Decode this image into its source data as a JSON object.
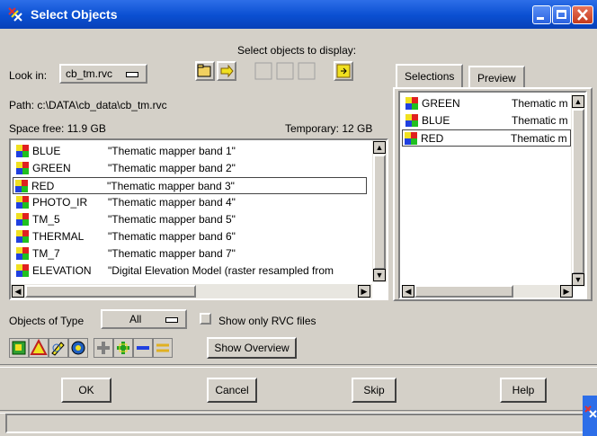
{
  "window": {
    "title": "Select Objects",
    "buttons": [
      "minimize-icon",
      "maximize-icon",
      "close-icon"
    ]
  },
  "header": {
    "prompt": "Select objects to display:"
  },
  "lookin": {
    "label": "Look in:",
    "value": "cb_tm.rvc"
  },
  "path": "Path: c:\\DATA\\cb_data\\cb_tm.rvc",
  "space_free": "Space free:  11.9 GB",
  "temporary": "Temporary: 12 GB",
  "objects": [
    {
      "name": "BLUE",
      "desc": "\"Thematic mapper band 1\""
    },
    {
      "name": "GREEN",
      "desc": "\"Thematic mapper band 2\""
    },
    {
      "name": "RED",
      "desc": "\"Thematic mapper band 3\""
    },
    {
      "name": "PHOTO_IR",
      "desc": "\"Thematic mapper band 4\""
    },
    {
      "name": "TM_5",
      "desc": "\"Thematic mapper band 5\""
    },
    {
      "name": "THERMAL",
      "desc": "\"Thematic mapper band 6\""
    },
    {
      "name": "TM_7",
      "desc": "\"Thematic mapper band 7\""
    },
    {
      "name": "ELEVATION",
      "desc": "\"Digital Elevation Model (raster resampled from"
    }
  ],
  "selected_object": "RED",
  "tabs": [
    {
      "label": "Selections",
      "active": true
    },
    {
      "label": "Preview",
      "active": false
    }
  ],
  "selections": [
    {
      "name": "GREEN",
      "desc": "Thematic m"
    },
    {
      "name": "BLUE",
      "desc": "Thematic m"
    },
    {
      "name": "RED",
      "desc": "Thematic m"
    }
  ],
  "objects_of_type": {
    "label": "Objects of Type",
    "value": "All"
  },
  "show_only_rvc": {
    "label": "Show only RVC files",
    "checked": false
  },
  "show_overview": "Show Overview",
  "footer_buttons": {
    "ok": "OK",
    "cancel": "Cancel",
    "skip": "Skip",
    "help": "Help"
  },
  "colors": {
    "titlebar": "#0a4fd1",
    "face": "#d4d0c8",
    "close": "#c43a1c"
  }
}
